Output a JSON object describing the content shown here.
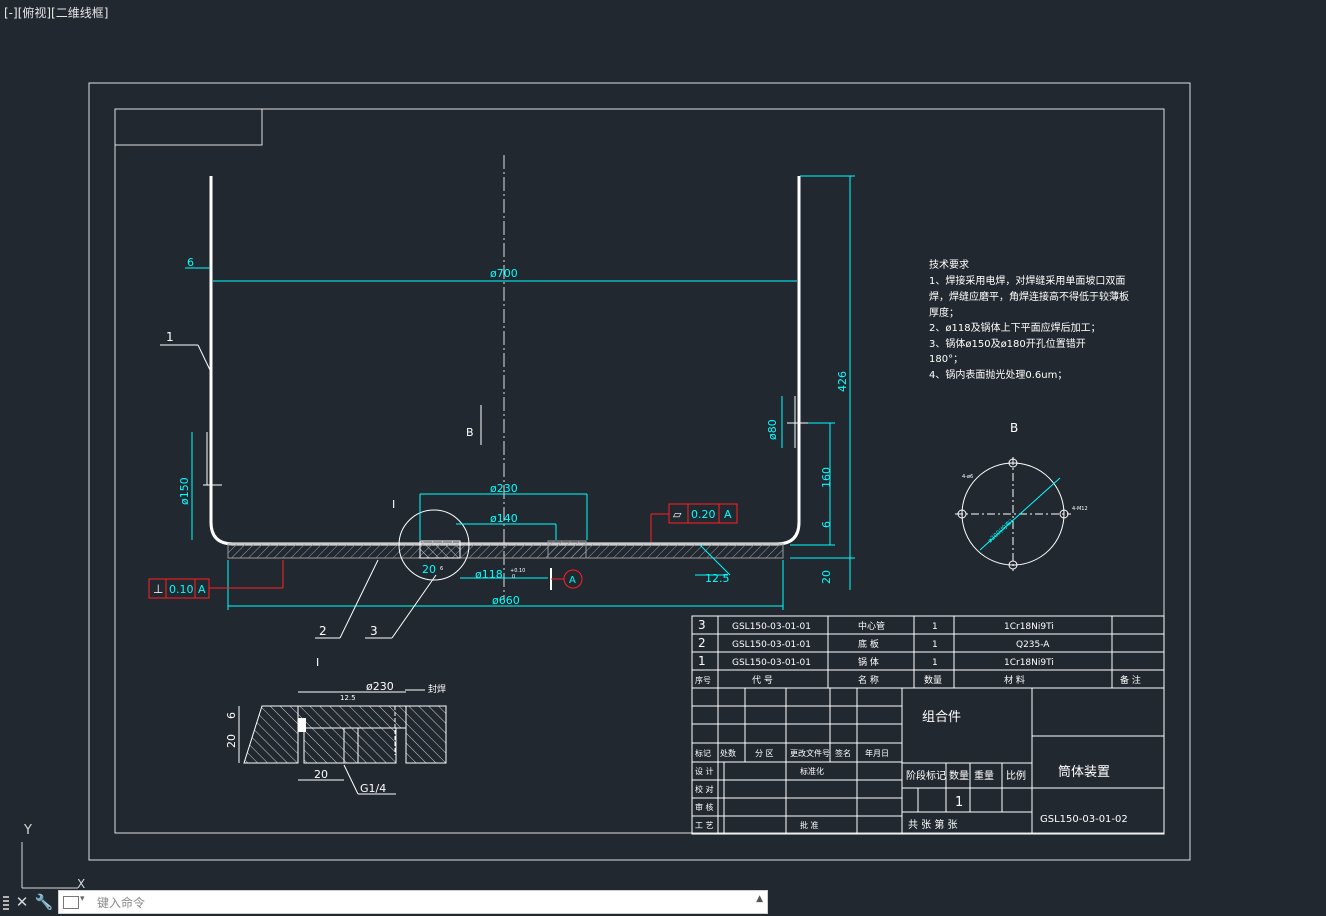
{
  "viewport": {
    "label": "[-][俯视][二维线框]"
  },
  "colors": {
    "background": "#212830",
    "white": "#ffffff",
    "cyan": "#00ffff",
    "red": "#ff2020",
    "hatch": "#9a9a9a"
  },
  "drawing": {
    "dims": {
      "d700": "ø700",
      "t6": "6",
      "h426": "426",
      "d80": "ø80",
      "d150": "ø150",
      "h160": "160",
      "h6b": "6",
      "h20": "20",
      "d230": "ø230",
      "d140": "ø140",
      "d118": "ø118",
      "tol_top": "+0.10",
      "tol_bot": "0",
      "d660": "ø660",
      "rough": "12.5",
      "det20": "20",
      "det_small": "G1/4",
      "det_tiny": "6"
    },
    "labels": {
      "view_b_arrow": "B",
      "section_mark": "I",
      "callout_1": "1",
      "callout_2": "2",
      "callout_3": "3",
      "datum": "A",
      "fc_flat_symbol": "⏥",
      "fc_flat_value": "0.20",
      "fc_flat_ref": "A",
      "fc_perp_symbol": "⊥",
      "fc_perp_value": "0.10",
      "fc_perp_ref": "A"
    },
    "detail": {
      "title": "I",
      "d230": "ø230",
      "rough": "12.5",
      "note": "封焊",
      "h6": "6",
      "h20": "20",
      "w20": "20",
      "thread": "G1/4"
    },
    "view_b": {
      "title": "B",
      "note_left": "4-ø6",
      "note_right": "4-M12",
      "pcd": "ø200(均布)"
    }
  },
  "tech_req": {
    "title": "技术要求",
    "lines": [
      "1、焊接采用电焊，对焊缝采用单面坡口双面",
      "焊，焊缝应磨平，角焊连接高不得低于较薄板",
      "厚度；",
      "2、ø118及锅体上下平面应焊后加工；",
      "3、锅体ø150及ø180开孔位置错开",
      "180°；",
      "4、锅内表面抛光处理0.6um；"
    ]
  },
  "bom": {
    "rows": [
      {
        "no": "3",
        "code": "GSL150-03-01-01",
        "name": "中心管",
        "qty": "1",
        "material": "1Cr18Ni9Ti",
        "note": ""
      },
      {
        "no": "2",
        "code": "GSL150-03-01-01",
        "name": "底  板",
        "qty": "1",
        "material": "Q235-A",
        "note": ""
      },
      {
        "no": "1",
        "code": "GSL150-03-01-01",
        "name": "锅  体",
        "qty": "1",
        "material": "1Cr18Ni9Ti",
        "note": ""
      }
    ],
    "header": {
      "no": "序号",
      "code": "代  号",
      "name": "名  称",
      "qty": "数量",
      "material": "材  料",
      "note": "备  注"
    }
  },
  "title_block": {
    "group": "组合件",
    "name": "筒体装置",
    "drawing_no": "GSL150-03-01-02",
    "stage": "阶段标记",
    "qty_label": "数量",
    "weight": "重量",
    "scale": "比例",
    "qty_value": "1",
    "sheets": "共  张  第  张",
    "rev_headers": [
      "标记",
      "处数",
      "分 区",
      "更改文件号",
      "签名",
      "年月日"
    ],
    "roles": [
      "设 计",
      "校 对",
      "审 核",
      "工 艺"
    ],
    "std": "标准化",
    "approve": "批 准"
  },
  "ucs": {
    "y": "Y",
    "x": "X"
  },
  "command": {
    "placeholder": "键入命令",
    "close_icon": "close-icon",
    "settings_icon": "wrench-icon"
  }
}
